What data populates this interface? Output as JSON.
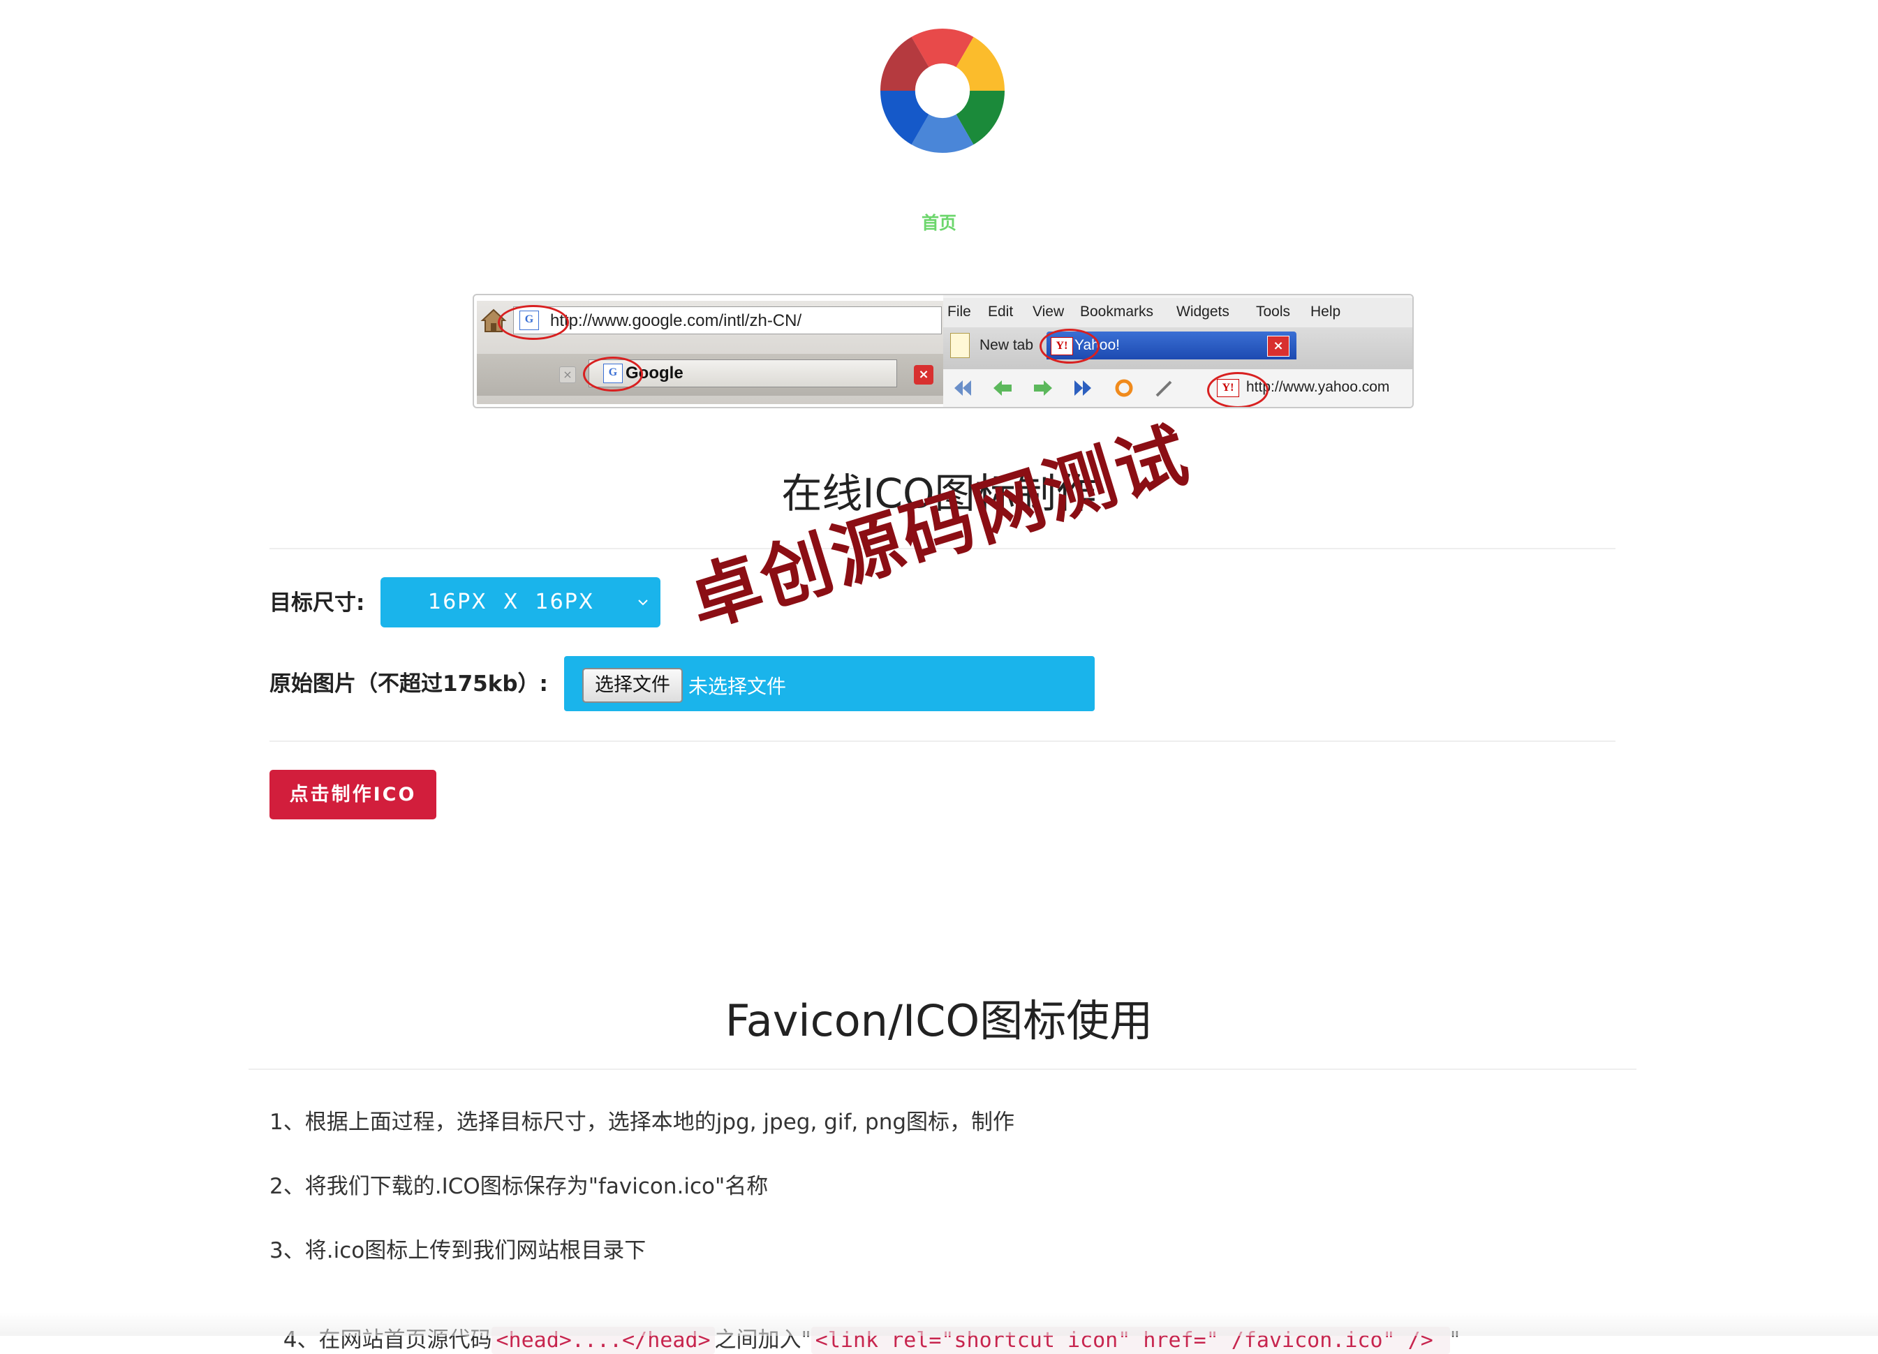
{
  "nav": {
    "home": "首页"
  },
  "colors": {
    "nav_link": "#6cd66c",
    "accent_blue": "#1ab4eb",
    "button_red": "#d21e3c",
    "watermark": "#8b0e14"
  },
  "browser_illustration": {
    "google_url": "http://www.google.com/intl/zh-CN/",
    "google_tab": "Google",
    "google_favicon": "G",
    "menu": [
      "File",
      "Edit",
      "View",
      "Bookmarks",
      "Widgets",
      "Tools",
      "Help"
    ],
    "new_tab": "New tab",
    "yahoo_tab": "Yahoo!",
    "yahoo_favicon": "Y!",
    "yahoo_url": "http://www.yahoo.com"
  },
  "tool": {
    "title": "在线ICO图标制作",
    "size_label": "目标尺寸:",
    "size_value": "16PX  X  16PX",
    "image_label": "原始图片（不超过175kb）:",
    "file_button": "选择文件",
    "file_status": "未选择文件",
    "submit": "点击制作ICO"
  },
  "watermark": "卓创源码网测试",
  "usage": {
    "title": "Favicon/ICO图标使用",
    "step1": "1、根据上面过程，选择目标尺寸，选择本地的jpg, jpeg, gif, png图标，制作",
    "step2": "2、将我们下载的.ICO图标保存为\"favicon.ico\"名称",
    "step3": "3、将.ico图标上传到我们网站根目录下",
    "step4_prefix": "4、在网站首页源代码",
    "step4_code1": "<head>....</head>",
    "step4_middle": "之间加入\"",
    "step4_code2": "<link rel=\"shortcut icon\" href=\" /favicon.ico\" /> ",
    "step4_suffix": "\""
  }
}
